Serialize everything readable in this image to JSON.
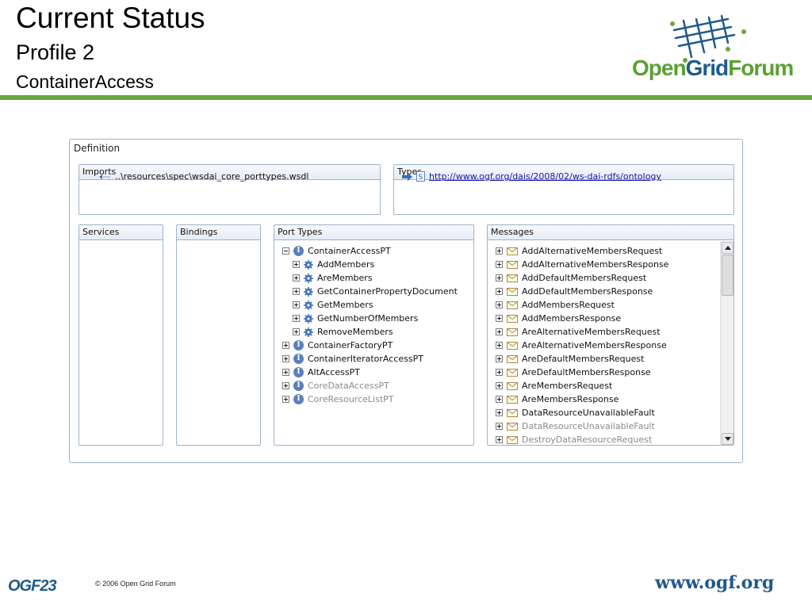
{
  "slide": {
    "title": "Current Status",
    "subtitle": "Profile 2",
    "subtitle2": "ContainerAccess"
  },
  "logo": {
    "open": "Open",
    "grid": "Grid",
    "forum": "Forum"
  },
  "definition": {
    "label": "Definition",
    "imports": {
      "header": "Imports",
      "item": "..\\resources\\spec\\wsdai_core_porttypes.wsdl"
    },
    "types": {
      "header": "Types",
      "item": "http://www.ogf.org/dais/2008/02/ws-dai-rdfs/ontology"
    },
    "services": {
      "header": "Services"
    },
    "bindings": {
      "header": "Bindings"
    },
    "port_types": {
      "header": "Port Types",
      "items": [
        {
          "label": "ContainerAccessPT",
          "level": 0,
          "kind": "interface",
          "expanded": true,
          "disabled": false
        },
        {
          "label": "AddMembers",
          "level": 1,
          "kind": "operation",
          "expanded": false,
          "disabled": false
        },
        {
          "label": "AreMembers",
          "level": 1,
          "kind": "operation",
          "expanded": false,
          "disabled": false
        },
        {
          "label": "GetContainerPropertyDocument",
          "level": 1,
          "kind": "operation",
          "expanded": false,
          "disabled": false
        },
        {
          "label": "GetMembers",
          "level": 1,
          "kind": "operation",
          "expanded": false,
          "disabled": false
        },
        {
          "label": "GetNumberOfMembers",
          "level": 1,
          "kind": "operation",
          "expanded": false,
          "disabled": false
        },
        {
          "label": "RemoveMembers",
          "level": 1,
          "kind": "operation",
          "expanded": false,
          "disabled": false
        },
        {
          "label": "ContainerFactoryPT",
          "level": 0,
          "kind": "interface",
          "expanded": false,
          "disabled": false
        },
        {
          "label": "ContainerIteratorAccessPT",
          "level": 0,
          "kind": "interface",
          "expanded": false,
          "disabled": false
        },
        {
          "label": "AltAccessPT",
          "level": 0,
          "kind": "interface",
          "expanded": false,
          "disabled": false
        },
        {
          "label": "CoreDataAccessPT",
          "level": 0,
          "kind": "interface",
          "expanded": false,
          "disabled": true
        },
        {
          "label": "CoreResourceListPT",
          "level": 0,
          "kind": "interface",
          "expanded": false,
          "disabled": true
        }
      ]
    },
    "messages": {
      "header": "Messages",
      "items": [
        {
          "label": "AddAlternativeMembersRequest",
          "disabled": false
        },
        {
          "label": "AddAlternativeMembersResponse",
          "disabled": false
        },
        {
          "label": "AddDefaultMembersRequest",
          "disabled": false
        },
        {
          "label": "AddDefaultMembersResponse",
          "disabled": false
        },
        {
          "label": "AddMembersRequest",
          "disabled": false
        },
        {
          "label": "AddMembersResponse",
          "disabled": false
        },
        {
          "label": "AreAlternativeMembersRequest",
          "disabled": false
        },
        {
          "label": "AreAlternativeMembersResponse",
          "disabled": false
        },
        {
          "label": "AreDefaultMembersRequest",
          "disabled": false
        },
        {
          "label": "AreDefaultMembersResponse",
          "disabled": false
        },
        {
          "label": "AreMembersRequest",
          "disabled": false
        },
        {
          "label": "AreMembersResponse",
          "disabled": false
        },
        {
          "label": "DataResourceUnavailableFault",
          "disabled": false
        },
        {
          "label": "DataResourceUnavailableFault",
          "disabled": true
        },
        {
          "label": "DestroyDataResourceRequest",
          "disabled": true
        }
      ]
    }
  },
  "footer": {
    "event": "OGF23",
    "copyright": "© 2006 Open Grid Forum",
    "url": "www.ogf.org"
  },
  "colors": {
    "accent_green": "#69a83a",
    "brand_blue": "#1f5a8c",
    "panel_border": "#9db3cc"
  }
}
